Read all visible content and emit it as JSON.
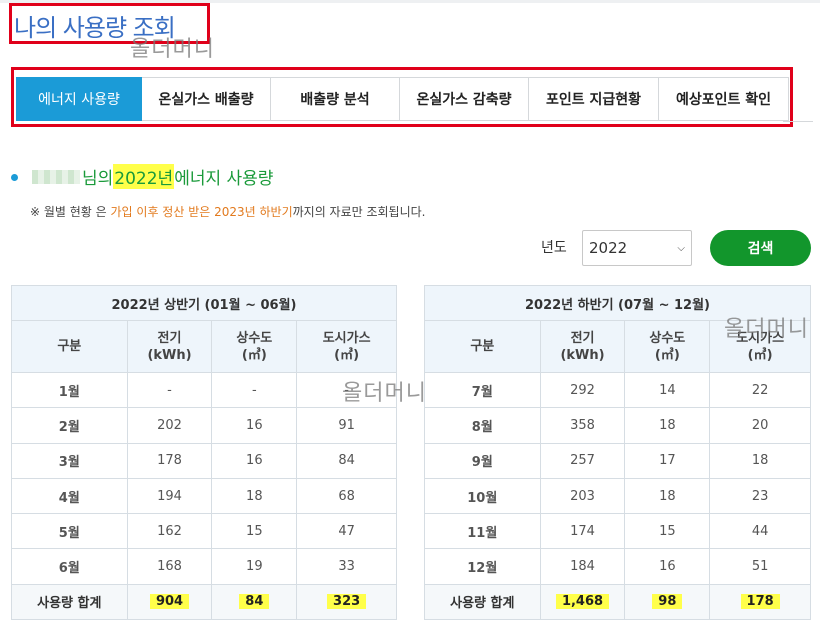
{
  "page": {
    "title": "나의 사용량 조회",
    "watermark": "올더머니"
  },
  "tabs": [
    {
      "label": "에너지 사용량",
      "active": true
    },
    {
      "label": "온실가스 배출량",
      "active": false
    },
    {
      "label": "배출량 분석",
      "active": false
    },
    {
      "label": "온실가스 감축량",
      "active": false
    },
    {
      "label": "포인트 지급현황",
      "active": false
    },
    {
      "label": "예상포인트 확인",
      "active": false
    }
  ],
  "section": {
    "name_suffix": "님의",
    "year_text": "2022년",
    "title_rest": "에너지 사용량"
  },
  "notice": {
    "prefix": "※ 월별 현황 은 ",
    "highlight1": "가입 이후 정산 받은 2023년 하반기",
    "suffix": "까지의 자료만 조회됩니다."
  },
  "search": {
    "year_label": "년도",
    "selected_year": "2022",
    "button": "검색"
  },
  "colors": {
    "accent_blue": "#1b9bd7",
    "accent_green": "#12962c",
    "highlight": "#ffff4a",
    "alert_red": "#e0001a"
  },
  "headers": {
    "category": "구분",
    "electric": "전기",
    "electric_unit": "(kWh)",
    "water": "상수도",
    "water_unit": "(㎥)",
    "gas": "도시가스",
    "gas_unit": "(㎥)"
  },
  "tables": [
    {
      "caption": "2022년 상반기 (01월 ~ 06월)",
      "rows": [
        {
          "month": "1월",
          "electric": "-",
          "water": "-",
          "gas": "-"
        },
        {
          "month": "2월",
          "electric": "202",
          "water": "16",
          "gas": "91"
        },
        {
          "month": "3월",
          "electric": "178",
          "water": "16",
          "gas": "84"
        },
        {
          "month": "4월",
          "electric": "194",
          "water": "18",
          "gas": "68"
        },
        {
          "month": "5월",
          "electric": "162",
          "water": "15",
          "gas": "47"
        },
        {
          "month": "6월",
          "electric": "168",
          "water": "19",
          "gas": "33"
        }
      ],
      "total": {
        "label": "사용량 합계",
        "electric": "904",
        "water": "84",
        "gas": "323"
      }
    },
    {
      "caption": "2022년 하반기 (07월 ~ 12월)",
      "rows": [
        {
          "month": "7월",
          "electric": "292",
          "water": "14",
          "gas": "22"
        },
        {
          "month": "8월",
          "electric": "358",
          "water": "18",
          "gas": "20"
        },
        {
          "month": "9월",
          "electric": "257",
          "water": "17",
          "gas": "18"
        },
        {
          "month": "10월",
          "electric": "203",
          "water": "18",
          "gas": "23"
        },
        {
          "month": "11월",
          "electric": "174",
          "water": "15",
          "gas": "44"
        },
        {
          "month": "12월",
          "electric": "184",
          "water": "16",
          "gas": "51"
        }
      ],
      "total": {
        "label": "사용량 합계",
        "electric": "1,468",
        "water": "98",
        "gas": "178"
      }
    }
  ]
}
